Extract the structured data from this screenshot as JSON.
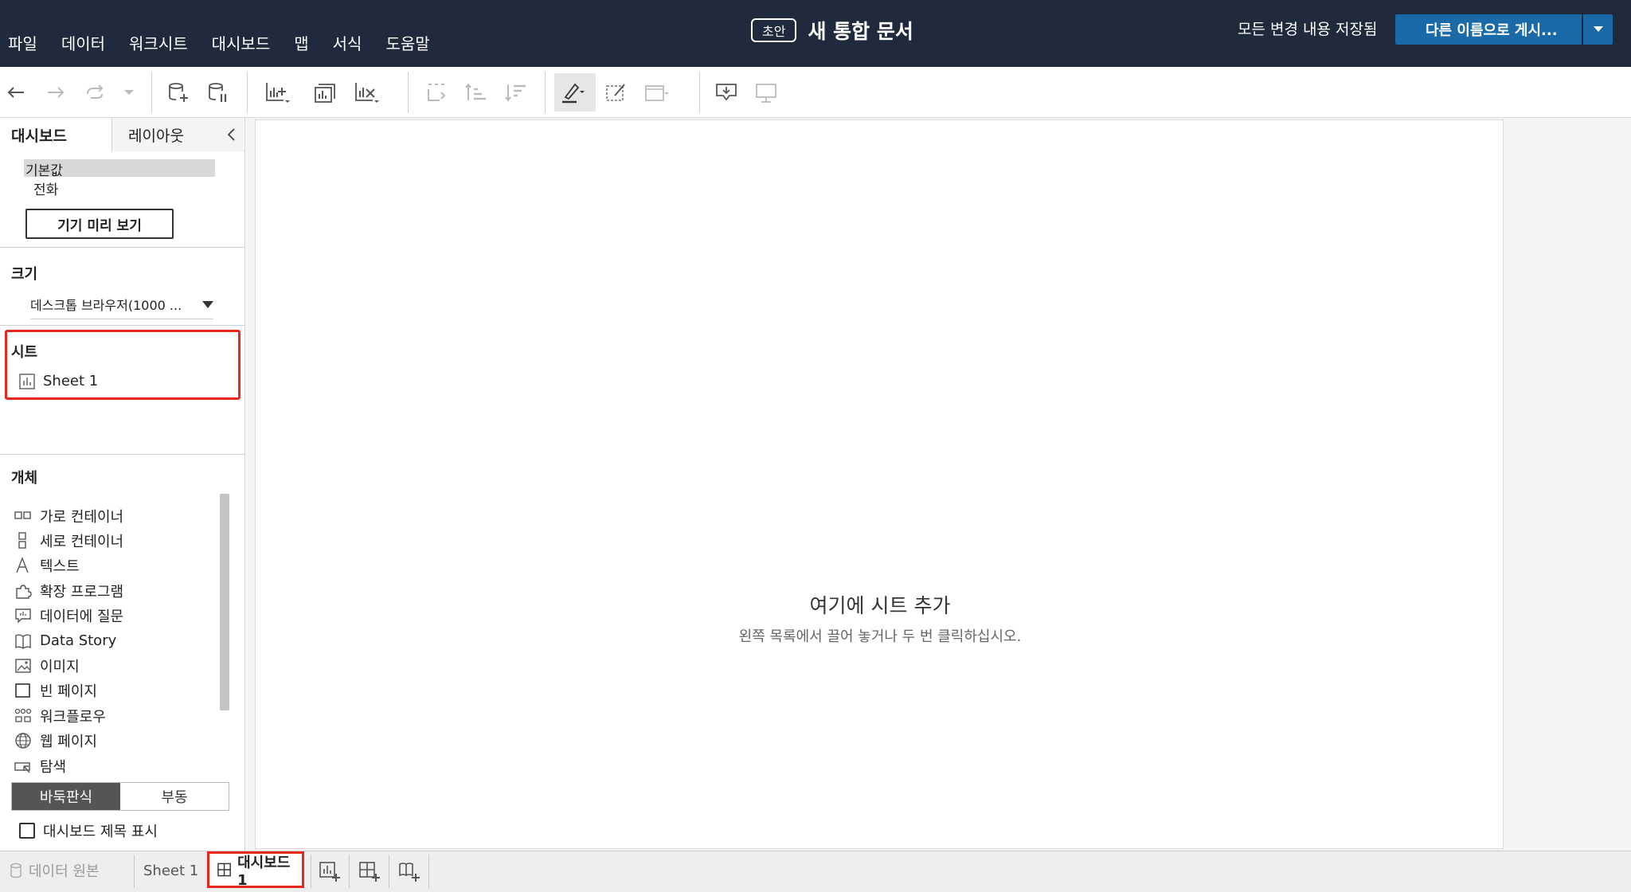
{
  "menu": [
    "파일",
    "데이터",
    "워크시트",
    "대시보드",
    "맵",
    "서식",
    "도움말"
  ],
  "header": {
    "draft_badge": "초안",
    "doc_title": "새 통합 문서",
    "save_status": "모든 변경 내용 저장됨",
    "publish_label": "다른 이름으로 게시..."
  },
  "panel": {
    "tab_dashboard": "대시보드",
    "tab_layout": "레이아웃",
    "device_default": "기본값",
    "device_phone": "전화",
    "preview_button": "기기 미리 보기",
    "size_title": "크기",
    "size_value": "데스크톱 브라우저(1000 ...",
    "sheets_title": "시트",
    "sheets": [
      "Sheet 1"
    ],
    "objects_title": "개체",
    "objects": [
      "가로 컨테이너",
      "세로 컨테이너",
      "텍스트",
      "확장 프로그램",
      "데이터에 질문",
      "Data Story",
      "이미지",
      "빈 페이지",
      "워크플로우",
      "웹 페이지",
      "탐색"
    ],
    "tiled_label": "바둑판식",
    "floating_label": "부동",
    "show_title_label": "대시보드 제목 표시"
  },
  "canvas": {
    "add_title": "여기에 시트 추가",
    "add_hint": "왼쪽 목록에서 끌어 놓거나 두 번 클릭하십시오."
  },
  "bottom": {
    "datasource": "데이터 원본",
    "sheet_tab": "Sheet 1",
    "dashboard_tab": "대시보드 1"
  },
  "colors": {
    "topbar": "#1f2a3c",
    "publish": "#1a6aa8",
    "highlight": "#e8281c"
  }
}
